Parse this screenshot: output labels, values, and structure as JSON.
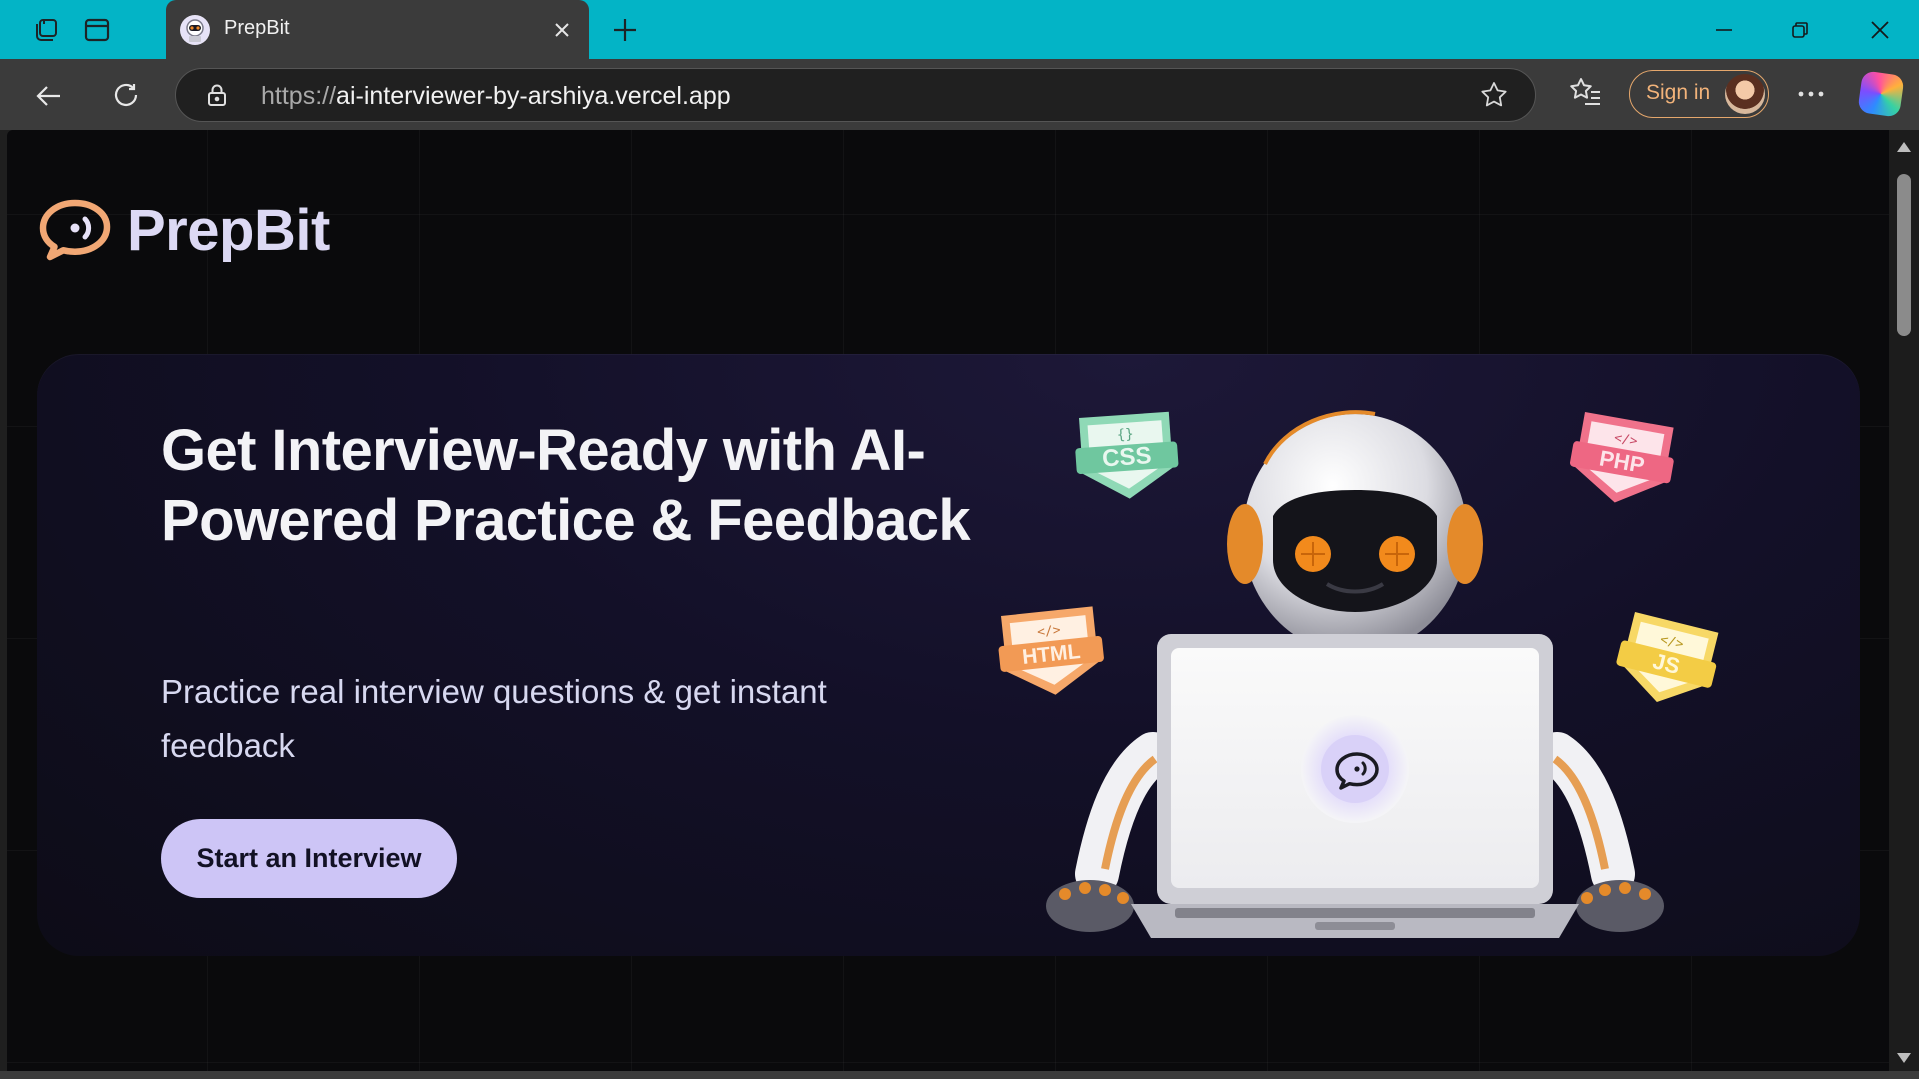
{
  "browser": {
    "tab": {
      "title": "PrepBit",
      "favicon": "prepbit-favicon"
    },
    "address": {
      "scheme": "https://",
      "host": "ai-interviewer-by-arshiya.vercel.app"
    },
    "profile": {
      "sign_in_label": "Sign in"
    },
    "icons": {
      "workspaces": "workspaces-icon",
      "tab_actions": "tab-actions-icon",
      "new_tab": "plus-icon",
      "minimize": "minimize-icon",
      "restore": "restore-icon",
      "close": "close-icon",
      "back": "back-arrow-icon",
      "refresh": "refresh-icon",
      "lock": "lock-icon",
      "favorite": "star-icon",
      "favorites": "favorites-icon",
      "more": "more-icon",
      "copilot": "copilot-icon"
    }
  },
  "page": {
    "brand": {
      "name": "PrepBit"
    },
    "hero": {
      "title": "Get Interview-Ready with AI-Powered Practice & Feedback",
      "subtitle": "Practice real interview questions & get instant feedback",
      "cta_label": "Start an Interview",
      "badges": [
        "CSS",
        "PHP",
        "HTML",
        "JS"
      ]
    }
  },
  "colors": {
    "titlebar": "#03b4c6",
    "page_bg": "#0a0a0c",
    "cta_bg": "#cdc5f6",
    "brand_text": "#dcd9f4",
    "logo_orange": "#f1a774"
  }
}
